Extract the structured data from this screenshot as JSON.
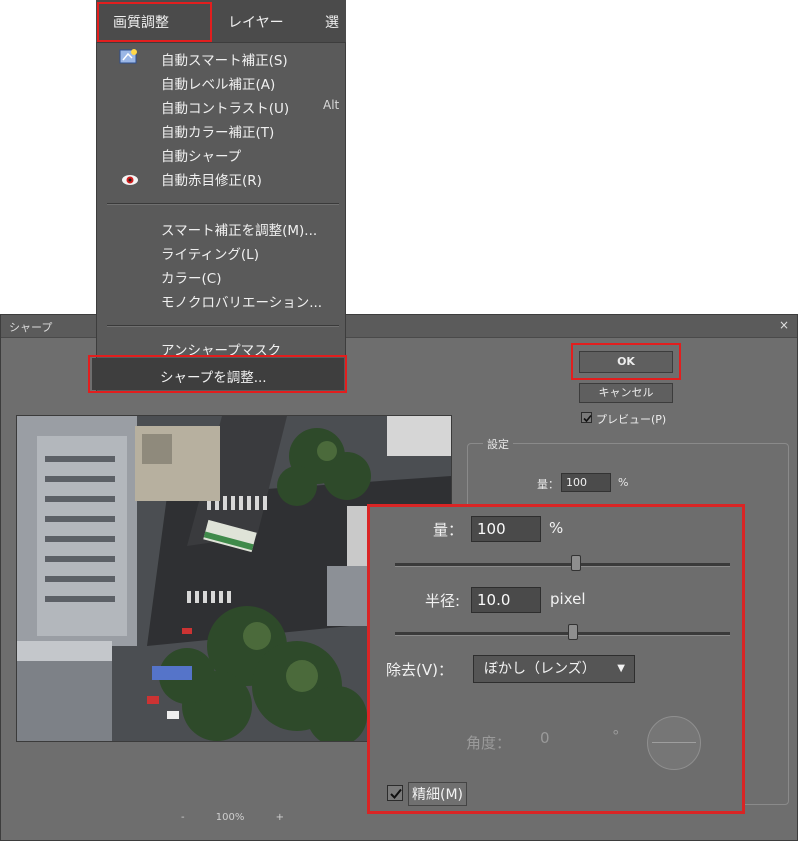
{
  "menubar": {
    "items": [
      "画質調整",
      "レイヤー",
      "選"
    ]
  },
  "menu": {
    "group1": [
      {
        "label": "自動スマート補正(S)",
        "icon": "auto-smart-fix-icon",
        "shortcut": ""
      },
      {
        "label": "自動レベル補正(A)",
        "icon": "",
        "shortcut": ""
      },
      {
        "label": "自動コントラスト(U)",
        "icon": "",
        "shortcut": "Alt"
      },
      {
        "label": "自動カラー補正(T)",
        "icon": "",
        "shortcut": ""
      },
      {
        "label": "自動シャープ",
        "icon": "",
        "shortcut": ""
      },
      {
        "label": "自動赤目修正(R)",
        "icon": "red-eye-icon",
        "shortcut": ""
      }
    ],
    "group2": [
      {
        "label": "スマート補正を調整(M)..."
      },
      {
        "label": "ライティング(L)"
      },
      {
        "label": "カラー(C)"
      },
      {
        "label": "モノクロバリエーション..."
      }
    ],
    "group3": [
      {
        "label": "アンシャープマスク"
      },
      {
        "label": "シャープを調整..."
      }
    ]
  },
  "dialog": {
    "title": "シャープ",
    "close": "×",
    "ok": "OK",
    "cancel": "キャンセル",
    "preview_label": "プレビュー(P)",
    "preview_checked": true,
    "settings_label": "設定",
    "amount_label": "量：",
    "amount_value": "100",
    "amount_unit": "%",
    "zoom_minus": "-",
    "zoom_level": "100%",
    "zoom_plus": "+"
  },
  "zoom_panel": {
    "amount_label": "量：",
    "amount_value": "100",
    "amount_unit": "%",
    "amount_slider": 0.54,
    "radius_label": "半径:",
    "radius_value": "10.0",
    "radius_unit": "pixel",
    "radius_slider": 0.53,
    "remove_label": "除去(V)：",
    "remove_value": "ぼかし（レンズ）",
    "angle_label": "角度：",
    "angle_value": "0",
    "angle_unit": "°",
    "fine_label": "精細(M)",
    "fine_checked": true
  },
  "colors": {
    "highlight_red": "#e21e1e",
    "dialog_bg": "#6e6e6e",
    "menu_bg": "#5a5a5a"
  }
}
